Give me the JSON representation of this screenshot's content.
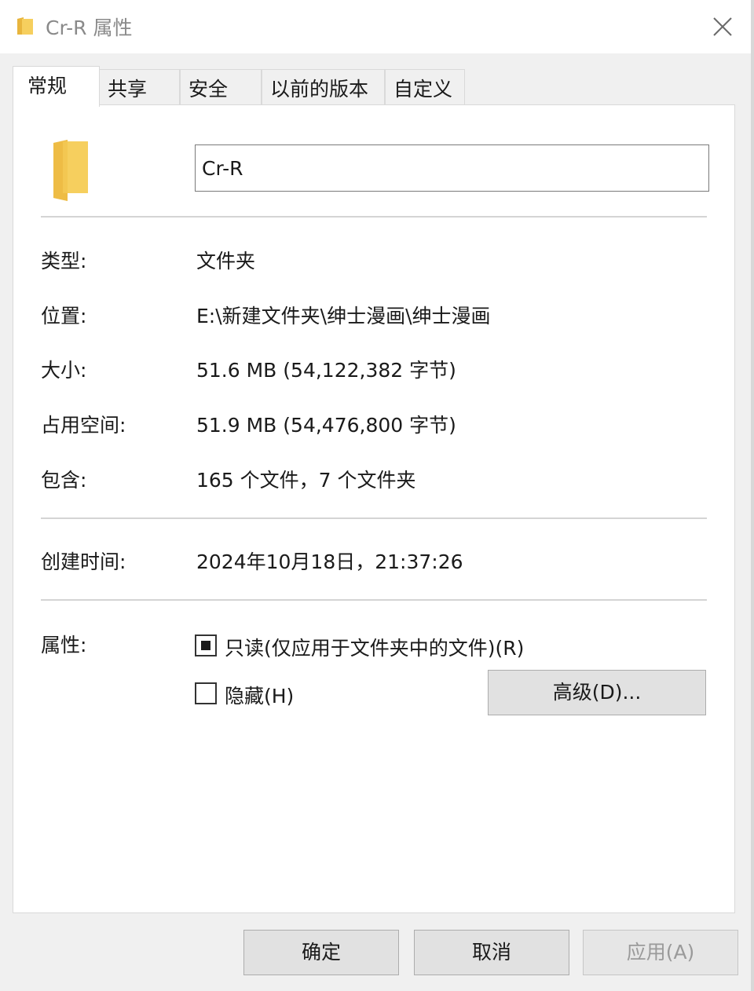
{
  "window": {
    "title": "Cr-R 属性",
    "icon": "folder-icon",
    "close_icon": "close-icon"
  },
  "tabs": [
    {
      "label": "常规",
      "active": true
    },
    {
      "label": "共享",
      "active": false
    },
    {
      "label": "安全",
      "active": false
    },
    {
      "label": "以前的版本",
      "active": false
    },
    {
      "label": "自定义",
      "active": false
    }
  ],
  "general": {
    "folder_name": "Cr-R",
    "type": {
      "label": "类型:",
      "value": "文件夹"
    },
    "location": {
      "label": "位置:",
      "value": "E:\\新建文件夹\\绅士漫画\\绅士漫画"
    },
    "size": {
      "label": "大小:",
      "value": "51.6 MB (54,122,382 字节)"
    },
    "size_on_disk": {
      "label": "占用空间:",
      "value": "51.9 MB (54,476,800 字节)"
    },
    "contains": {
      "label": "包含:",
      "value": "165 个文件，7 个文件夹"
    },
    "created": {
      "label": "创建时间:",
      "value": "2024年10月18日，21:37:26"
    },
    "attributes": {
      "label": "属性:",
      "readonly": {
        "label": "只读(仅应用于文件夹中的文件)(R)",
        "state": "indeterminate"
      },
      "hidden": {
        "label": "隐藏(H)",
        "state": "unchecked"
      },
      "advanced_button": "高级(D)..."
    }
  },
  "footer": {
    "ok": "确定",
    "cancel": "取消",
    "apply": "应用(A)",
    "apply_enabled": false
  },
  "colors": {
    "window_bg": "#f0f0f0",
    "panel_bg": "#ffffff",
    "folder_yellow": "#f6cf5e",
    "button_bg": "#e1e1e1"
  }
}
